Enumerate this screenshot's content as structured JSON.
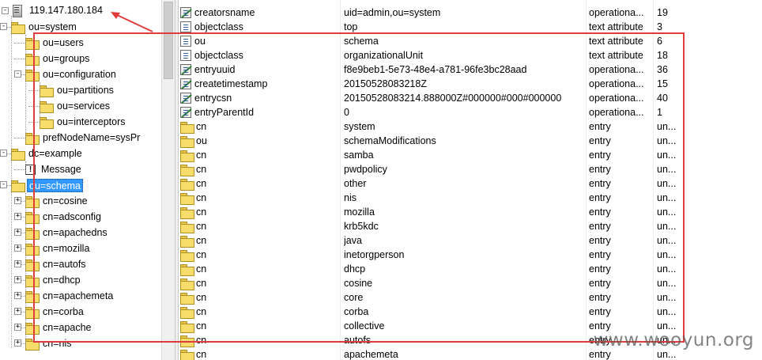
{
  "tree": {
    "server": "119.147.180.184",
    "nodes": [
      {
        "label": "ou=system",
        "level": 1,
        "expander": "-"
      },
      {
        "label": "ou=users",
        "level": 2,
        "expander": ""
      },
      {
        "label": "ou=groups",
        "level": 2,
        "expander": ""
      },
      {
        "label": "ou=configuration",
        "level": 2,
        "expander": "-"
      },
      {
        "label": "ou=partitions",
        "level": 3,
        "expander": ""
      },
      {
        "label": "ou=services",
        "level": 3,
        "expander": ""
      },
      {
        "label": "ou=interceptors",
        "level": 3,
        "expander": ""
      },
      {
        "label": "prefNodeName=sysPr",
        "level": 2,
        "expander": ""
      },
      {
        "label": "dc=example",
        "level": 1,
        "expander": "-"
      },
      {
        "label": "Message",
        "level": 2,
        "expander": ""
      },
      {
        "label": "ou=schema",
        "level": 1,
        "expander": "-"
      },
      {
        "label": "cn=cosine",
        "level": 2,
        "expander": "+"
      },
      {
        "label": "cn=adsconfig",
        "level": 2,
        "expander": "+"
      },
      {
        "label": "cn=apachedns",
        "level": 2,
        "expander": "+"
      },
      {
        "label": "cn=mozilla",
        "level": 2,
        "expander": "+"
      },
      {
        "label": "cn=autofs",
        "level": 2,
        "expander": "+"
      },
      {
        "label": "cn=dhcp",
        "level": 2,
        "expander": "+"
      },
      {
        "label": "cn=apachemeta",
        "level": 2,
        "expander": "+"
      },
      {
        "label": "cn=corba",
        "level": 2,
        "expander": "+"
      },
      {
        "label": "cn=apache",
        "level": 2,
        "expander": "+"
      },
      {
        "label": "cn=nis",
        "level": 2,
        "expander": "+"
      }
    ],
    "selected_index": 10
  },
  "list": {
    "rows": [
      {
        "name": "creatorsname",
        "value": "uid=admin,ou=system",
        "type": "operationa...",
        "size": "19",
        "icon": "operational-attribute-icon"
      },
      {
        "name": "objectclass",
        "value": "top",
        "type": "text attribute",
        "size": "3",
        "icon": "text-attribute-icon"
      },
      {
        "name": "ou",
        "value": "schema",
        "type": "text attribute",
        "size": "6",
        "icon": "text-attribute-icon"
      },
      {
        "name": "objectclass",
        "value": "organizationalUnit",
        "type": "text attribute",
        "size": "18",
        "icon": "text-attribute-icon"
      },
      {
        "name": "entryuuid",
        "value": "f8e9beb1-5e73-48e4-a781-96fe3bc28aad",
        "type": "operationa...",
        "size": "36",
        "icon": "operational-attribute-icon"
      },
      {
        "name": "createtimestamp",
        "value": "20150528083218Z",
        "type": "operationa...",
        "size": "15",
        "icon": "operational-attribute-icon"
      },
      {
        "name": "entrycsn",
        "value": "20150528083214.888000Z#000000#000#000000",
        "type": "operationa...",
        "size": "40",
        "icon": "operational-attribute-icon"
      },
      {
        "name": "entryParentId",
        "value": "0",
        "type": "operationa...",
        "size": "1",
        "icon": "operational-attribute-icon"
      },
      {
        "name": "cn",
        "value": "system",
        "type": "entry",
        "size": "un...",
        "icon": "folder-icon"
      },
      {
        "name": "ou",
        "value": "schemaModifications",
        "type": "entry",
        "size": "un...",
        "icon": "folder-icon"
      },
      {
        "name": "cn",
        "value": "samba",
        "type": "entry",
        "size": "un...",
        "icon": "folder-icon"
      },
      {
        "name": "cn",
        "value": "pwdpolicy",
        "type": "entry",
        "size": "un...",
        "icon": "folder-icon"
      },
      {
        "name": "cn",
        "value": "other",
        "type": "entry",
        "size": "un...",
        "icon": "folder-icon"
      },
      {
        "name": "cn",
        "value": "nis",
        "type": "entry",
        "size": "un...",
        "icon": "folder-icon"
      },
      {
        "name": "cn",
        "value": "mozilla",
        "type": "entry",
        "size": "un...",
        "icon": "folder-icon"
      },
      {
        "name": "cn",
        "value": "krb5kdc",
        "type": "entry",
        "size": "un...",
        "icon": "folder-icon"
      },
      {
        "name": "cn",
        "value": "java",
        "type": "entry",
        "size": "un...",
        "icon": "folder-icon"
      },
      {
        "name": "cn",
        "value": "inetorgperson",
        "type": "entry",
        "size": "un...",
        "icon": "folder-icon"
      },
      {
        "name": "cn",
        "value": "dhcp",
        "type": "entry",
        "size": "un...",
        "icon": "folder-icon"
      },
      {
        "name": "cn",
        "value": "cosine",
        "type": "entry",
        "size": "un...",
        "icon": "folder-icon"
      },
      {
        "name": "cn",
        "value": "core",
        "type": "entry",
        "size": "un...",
        "icon": "folder-icon"
      },
      {
        "name": "cn",
        "value": "corba",
        "type": "entry",
        "size": "un...",
        "icon": "folder-icon"
      },
      {
        "name": "cn",
        "value": "collective",
        "type": "entry",
        "size": "un...",
        "icon": "folder-icon"
      },
      {
        "name": "cn",
        "value": "autofs",
        "type": "entry",
        "size": "un...",
        "icon": "folder-icon"
      },
      {
        "name": "cn",
        "value": "apachemeta",
        "type": "entry",
        "size": "un...",
        "icon": "folder-icon"
      }
    ]
  },
  "annotation": {
    "color": "#e03c3c"
  },
  "watermark": "www.wooyun.org"
}
